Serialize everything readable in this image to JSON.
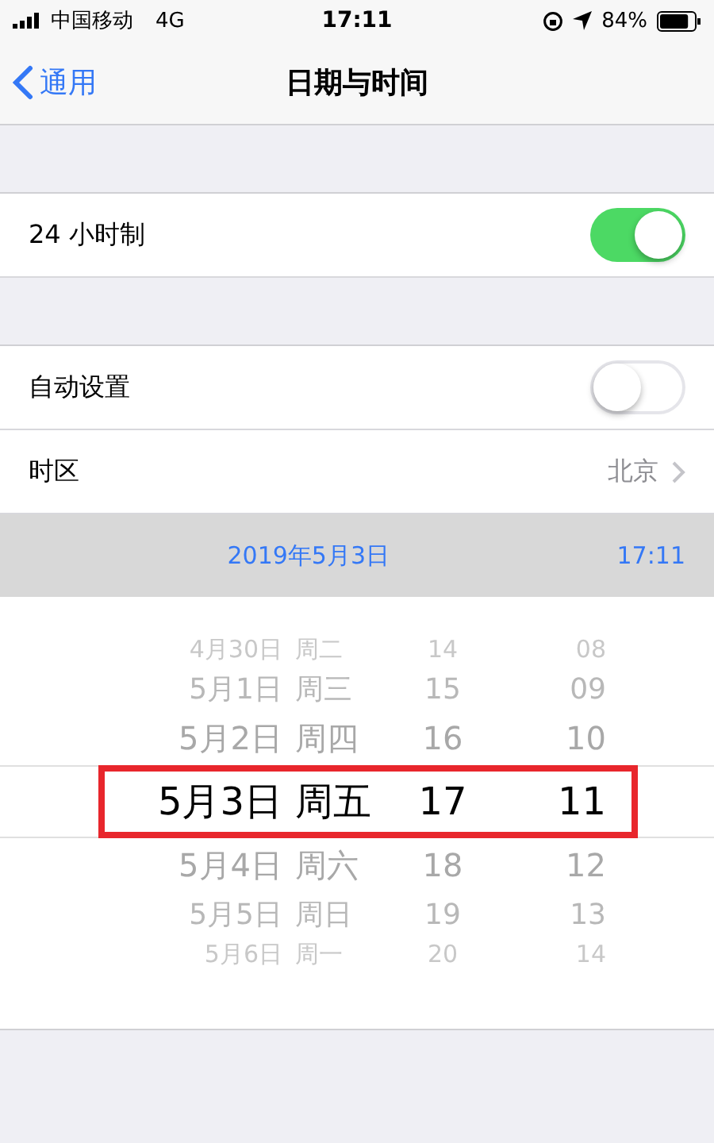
{
  "status_bar": {
    "carrier": "中国移动",
    "network": "4G",
    "time": "17:11",
    "battery": "84%"
  },
  "nav": {
    "back": "通用",
    "title": "日期与时间"
  },
  "settings_groups": [
    [
      {
        "kind": "toggle",
        "label": "24 小时制",
        "on": true
      }
    ],
    [
      {
        "kind": "toggle",
        "label": "自动设置",
        "on": false
      },
      {
        "kind": "link",
        "label": "时区",
        "value": "北京"
      }
    ]
  ],
  "date_bar": {
    "date": "2019年5月3日",
    "time": "17:11"
  },
  "picker": {
    "highlighted": true,
    "rows": [
      {
        "date": "4月30日",
        "weekday": "周二",
        "hour": "14",
        "minute": "08",
        "selected": false
      },
      {
        "date": "5月1日",
        "weekday": "周三",
        "hour": "15",
        "minute": "09",
        "selected": false
      },
      {
        "date": "5月2日",
        "weekday": "周四",
        "hour": "16",
        "minute": "10",
        "selected": false
      },
      {
        "date": "5月3日",
        "weekday": "周五",
        "hour": "17",
        "minute": "11",
        "selected": true
      },
      {
        "date": "5月4日",
        "weekday": "周六",
        "hour": "18",
        "minute": "12",
        "selected": false
      },
      {
        "date": "5月5日",
        "weekday": "周日",
        "hour": "19",
        "minute": "13",
        "selected": false
      },
      {
        "date": "5月6日",
        "weekday": "周一",
        "hour": "20",
        "minute": "14",
        "selected": false
      }
    ]
  }
}
